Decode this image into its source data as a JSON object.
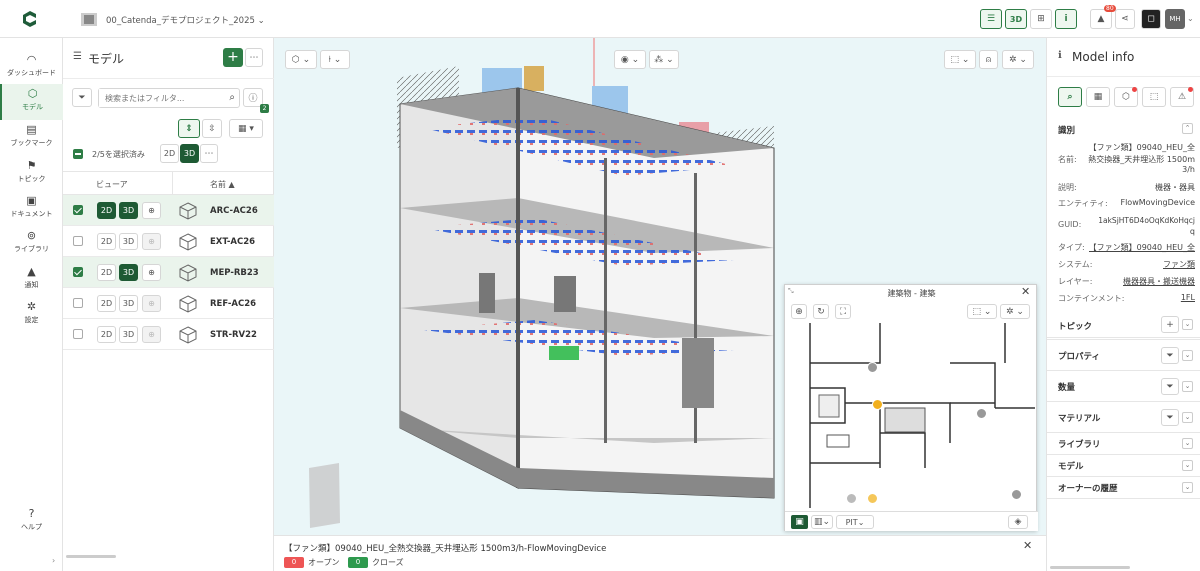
{
  "topbar": {
    "project": "00_Catenda_デモプロジェクト_2025",
    "notif_count": "80",
    "mode_3d": "3D",
    "avatar": "MH"
  },
  "leftnav": [
    {
      "label": "ダッシュボード",
      "icon": "dashboard-icon"
    },
    {
      "label": "モデル",
      "icon": "model-cube-icon"
    },
    {
      "label": "ブックマーク",
      "icon": "bookmark-icon"
    },
    {
      "label": "トピック",
      "icon": "topic-icon"
    },
    {
      "label": "ドキュメント",
      "icon": "document-icon"
    },
    {
      "label": "ライブラリ",
      "icon": "library-icon"
    },
    {
      "label": "通知",
      "icon": "bell-icon"
    },
    {
      "label": "設定",
      "icon": "gear-icon"
    }
  ],
  "help": "ヘルプ",
  "models": {
    "title": "モデル",
    "search_placeholder": "検索またはフィルタ...",
    "filter_badge": "2",
    "selected": "2/5を選択済み",
    "btn_2d": "2D",
    "btn_3d": "3D",
    "col_viewer": "ビューア",
    "col_name": "名前",
    "rows": [
      {
        "name": "ARC-AC26",
        "checked": true,
        "mode": "both"
      },
      {
        "name": "EXT-AC26",
        "checked": false,
        "mode": "none"
      },
      {
        "name": "MEP-RB23",
        "checked": true,
        "mode": "3d"
      },
      {
        "name": "REF-AC26",
        "checked": false,
        "mode": "none"
      },
      {
        "name": "STR-RV22",
        "checked": false,
        "mode": "none"
      }
    ]
  },
  "minimap": {
    "title": "建築物 - 建築",
    "level": "PIT"
  },
  "status": {
    "title": "【ファン類】09040_HEU_全熱交換器_天井埋込形 1500m3/h-FlowMovingDevice",
    "open_count": "0",
    "open_label": "オープン",
    "closed_count": "0",
    "closed_label": "クローズ"
  },
  "info": {
    "title": "Model info",
    "ident": "識別",
    "name_top": "【ファン類】09040_HEU_全",
    "name_label": "名前:",
    "name_val1": "熱交換器_天井埋込形 1500m",
    "name_val2": "3/h",
    "desc_label": "説明:",
    "desc": "機器・器具",
    "entity_label": "エンティティ:",
    "entity": "FlowMovingDevice",
    "guid_label": "GUID:",
    "guid1": "1akSjHT6D4oOqKdKoHqcj",
    "guid2": "q",
    "type_label": "タイプ:",
    "type": "【ファン類】09040_HEU_全",
    "system_label": "システム:",
    "system": "ファン類",
    "layer_label": "レイヤー:",
    "layer": "機器器具・搬送機器",
    "container_label": "コンテインメント:",
    "container": "1FL",
    "sections": [
      "トピック",
      "プロパティ",
      "数量",
      "マテリアル",
      "ライブラリ",
      "モデル",
      "オーナーの履歴"
    ]
  }
}
